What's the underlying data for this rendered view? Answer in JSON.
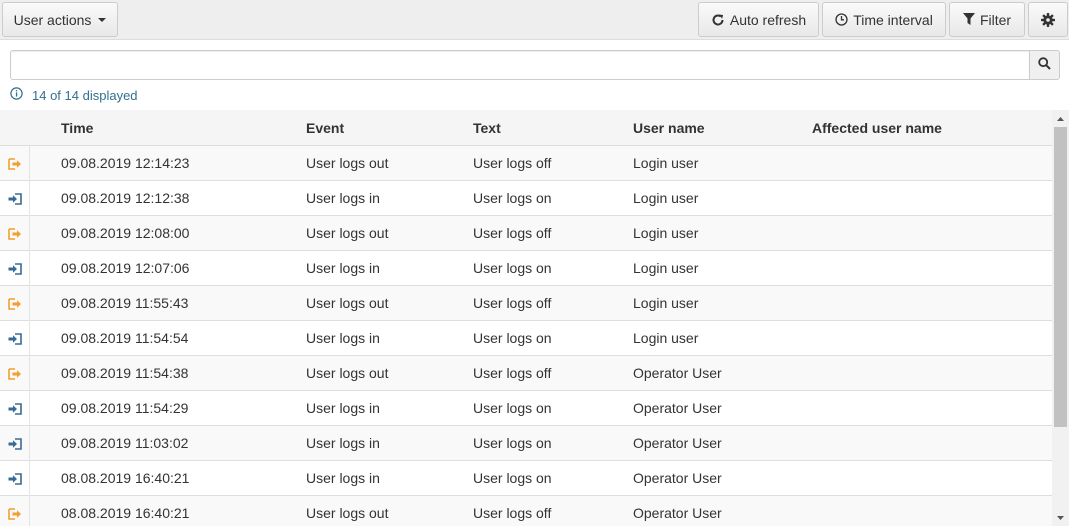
{
  "toolbar": {
    "user_actions_label": "User actions",
    "auto_refresh_label": "Auto refresh",
    "time_interval_label": "Time interval",
    "filter_label": "Filter"
  },
  "search": {
    "value": "",
    "placeholder": ""
  },
  "info": {
    "text": "14 of 14 displayed"
  },
  "colors": {
    "logout_icon": "#f0a030",
    "login_icon": "#3a6a94",
    "info_text": "#31708f"
  },
  "table": {
    "columns": {
      "time": "Time",
      "event": "Event",
      "text": "Text",
      "user_name": "User name",
      "affected_user_name": "Affected user name"
    },
    "rows": [
      {
        "icon": "logout-icon",
        "time": "09.08.2019 12:14:23",
        "event": "User logs out",
        "text": "User logs off",
        "user": "Login user",
        "affected": ""
      },
      {
        "icon": "login-icon",
        "time": "09.08.2019 12:12:38",
        "event": "User logs in",
        "text": "User logs on",
        "user": "Login user",
        "affected": ""
      },
      {
        "icon": "logout-icon",
        "time": "09.08.2019 12:08:00",
        "event": "User logs out",
        "text": "User logs off",
        "user": "Login user",
        "affected": ""
      },
      {
        "icon": "login-icon",
        "time": "09.08.2019 12:07:06",
        "event": "User logs in",
        "text": "User logs on",
        "user": "Login user",
        "affected": ""
      },
      {
        "icon": "logout-icon",
        "time": "09.08.2019 11:55:43",
        "event": "User logs out",
        "text": "User logs off",
        "user": "Login user",
        "affected": ""
      },
      {
        "icon": "login-icon",
        "time": "09.08.2019 11:54:54",
        "event": "User logs in",
        "text": "User logs on",
        "user": "Login user",
        "affected": ""
      },
      {
        "icon": "logout-icon",
        "time": "09.08.2019 11:54:38",
        "event": "User logs out",
        "text": "User logs off",
        "user": "Operator User",
        "affected": ""
      },
      {
        "icon": "login-icon",
        "time": "09.08.2019 11:54:29",
        "event": "User logs in",
        "text": "User logs on",
        "user": "Operator User",
        "affected": ""
      },
      {
        "icon": "login-icon",
        "time": "09.08.2019 11:03:02",
        "event": "User logs in",
        "text": "User logs on",
        "user": "Operator User",
        "affected": ""
      },
      {
        "icon": "login-icon",
        "time": "08.08.2019 16:40:21",
        "event": "User logs in",
        "text": "User logs on",
        "user": "Operator User",
        "affected": ""
      },
      {
        "icon": "logout-icon",
        "time": "08.08.2019 16:40:21",
        "event": "User logs out",
        "text": "User logs off",
        "user": "Operator User",
        "affected": ""
      }
    ]
  }
}
